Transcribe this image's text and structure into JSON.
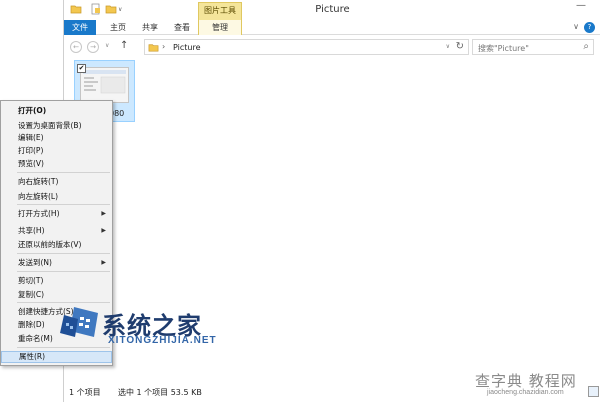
{
  "window": {
    "title": "Picture",
    "contextual_tab_group": "图片工具",
    "minimize_glyph": "—"
  },
  "ribbon": {
    "tabs": [
      "文件",
      "主页",
      "共享",
      "查看",
      "管理"
    ],
    "ribbon_toggle_glyph": "∨",
    "help_glyph": "?"
  },
  "navigation": {
    "back_glyph": "←",
    "forward_glyph": "→",
    "recent_glyph": "∨",
    "up_glyph": "↑",
    "address": "Picture",
    "breadcrumb_separator": "›",
    "address_dropdown_glyph": "∨",
    "refresh_glyph": "↻",
    "search_placeholder": "搜索\"Picture\"",
    "search_icon_glyph": "⌕"
  },
  "files": [
    {
      "name_fragment": "_080",
      "selected": true,
      "checkbox_glyph": "✔"
    }
  ],
  "status": {
    "item_count": "1 个项目",
    "selection": "选中 1 个项目  53.5 KB"
  },
  "context_menu": {
    "submenu_glyph": "▶",
    "items": [
      {
        "label": "打开(O)",
        "bold": true,
        "submenu": false
      },
      {
        "label": "设置为桌面背景(B)",
        "submenu": false
      },
      {
        "label": "编辑(E)",
        "submenu": false
      },
      {
        "label": "打印(P)",
        "submenu": false
      },
      {
        "label": "预览(V)",
        "submenu": false
      },
      {
        "label": "向右旋转(T)",
        "submenu": false
      },
      {
        "label": "向左旋转(L)",
        "submenu": false
      },
      {
        "label": "打开方式(H)",
        "submenu": true
      },
      {
        "label": "共享(H)",
        "submenu": true
      },
      {
        "label": "还原以前的版本(V)",
        "submenu": false
      },
      {
        "label": "发送到(N)",
        "submenu": true
      },
      {
        "label": "剪切(T)",
        "submenu": false
      },
      {
        "label": "复制(C)",
        "submenu": false
      },
      {
        "label": "创建快捷方式(S)",
        "submenu": false
      },
      {
        "label": "删除(D)",
        "submenu": false
      },
      {
        "label": "重命名(M)",
        "submenu": false
      },
      {
        "label": "属性(R)",
        "submenu": false,
        "highlighted": true
      }
    ]
  },
  "watermarks": {
    "site_cn": "系统之家",
    "site_en": "XITONGZHIJIA.NET",
    "site2_main": "查字典 教程网",
    "site2_sub": "jiaocheng.chazidian.com"
  },
  "colors": {
    "file_tab": "#1979ca",
    "contextual_tab": "#f4e59a",
    "selection": "#cce8ff",
    "menu_highlight": "#d6e7f8"
  }
}
